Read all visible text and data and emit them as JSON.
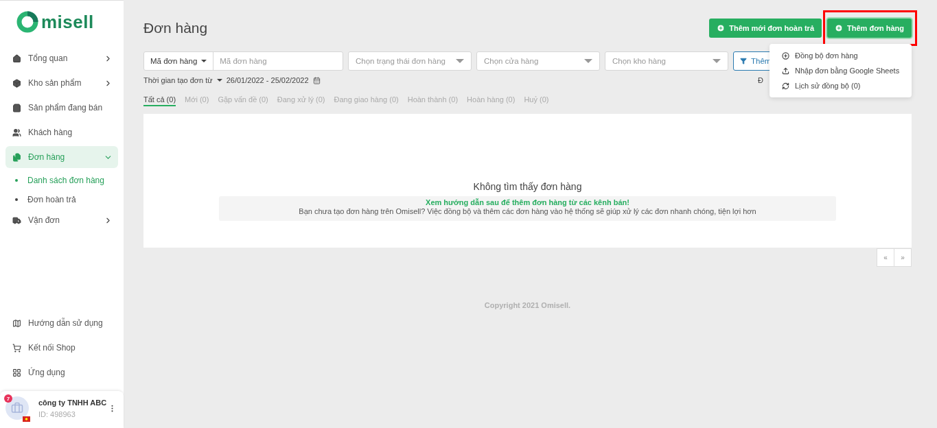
{
  "sidebar": {
    "logo": "misell",
    "items": [
      {
        "label": "Tổng quan",
        "kind": "group",
        "expanded": false,
        "selected": false
      },
      {
        "label": "Kho sản phẩm",
        "kind": "group",
        "expanded": false,
        "selected": false
      },
      {
        "label": "Sản phẩm đang bán",
        "kind": "link",
        "expanded": false,
        "selected": false
      },
      {
        "label": "Khách hàng",
        "kind": "link",
        "expanded": false,
        "selected": false
      },
      {
        "label": "Đơn hàng",
        "kind": "group",
        "expanded": true,
        "selected": true,
        "children": [
          {
            "label": "Danh sách đơn hàng",
            "selected": true
          },
          {
            "label": "Đơn hoàn trả",
            "selected": false
          }
        ]
      },
      {
        "label": "Vận đơn",
        "kind": "group",
        "expanded": false,
        "selected": false
      }
    ],
    "bottom_items": [
      {
        "label": "Hướng dẫn sử dụng"
      },
      {
        "label": "Kết nối Shop"
      },
      {
        "label": "Ứng dụng"
      }
    ],
    "account": {
      "name": "công ty TNHH ABC",
      "id": "ID: 498963",
      "badge": "7"
    }
  },
  "page": {
    "title": "Đơn hàng",
    "buttons": [
      {
        "label": "Thêm mới đơn hoàn trả",
        "highlighted": false
      },
      {
        "label": "Thêm đơn hàng",
        "highlighted": true
      }
    ],
    "dropdown_menu": [
      {
        "label": "Đồng bộ đơn hàng"
      },
      {
        "label": "Nhập đơn bằng Google Sheets"
      },
      {
        "label": "Lịch sử đồng bộ (0)"
      }
    ],
    "filters": {
      "search_type": "Mã đơn hàng",
      "search_placeholder": "Mã đơn hàng",
      "selects": [
        "Chọn trạng thái đơn hàng",
        "Chọn cửa hàng",
        "Chọn kho hàng"
      ],
      "more_button": "Thêm",
      "date_label": "Thời gian tạo đơn từ",
      "date_range": "26/01/2022 - 25/02/2022",
      "partial_text": "Đ"
    },
    "tabs": [
      {
        "label": "Tất cả (0)",
        "selected": true
      },
      {
        "label": "Mới (0)",
        "selected": false
      },
      {
        "label": "Gặp vấn đề (0)",
        "selected": false
      },
      {
        "label": "Đang xử lý (0)",
        "selected": false
      },
      {
        "label": "Đang giao hàng (0)",
        "selected": false
      },
      {
        "label": "Hoàn thành (0)",
        "selected": false
      },
      {
        "label": "Hoàn hàng (0)",
        "selected": false
      },
      {
        "label": "Huỷ (0)",
        "selected": false
      }
    ],
    "empty": {
      "title": "Không tìm thấy đơn hàng",
      "link": "Xem hướng dẫn sau để thêm đơn hàng từ các kênh bán!",
      "message": "Bạn chưa tạo đơn hàng trên Omisell? Việc đồng bộ và thêm các đơn hàng vào hệ thống sẽ giúp xử lý các đơn nhanh chóng, tiện lợi hơn"
    },
    "pagination": [
      "«",
      "»"
    ],
    "footer": "Copyright 2021 Omisell."
  }
}
